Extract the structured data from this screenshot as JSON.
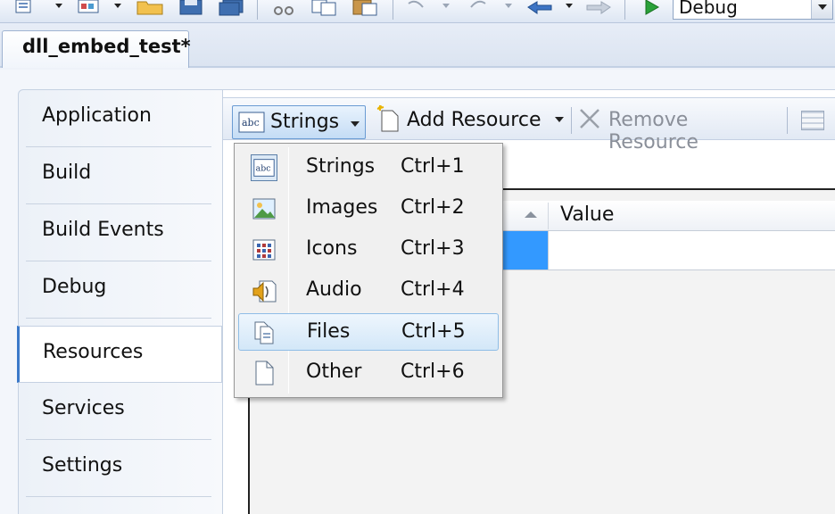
{
  "toolbar": {
    "configuration": "Debug"
  },
  "document_tab": {
    "title": "dll_embed_test*"
  },
  "left_nav": {
    "items": [
      {
        "label": "Application"
      },
      {
        "label": "Build"
      },
      {
        "label": "Build Events"
      },
      {
        "label": "Debug"
      },
      {
        "label": "Resources",
        "selected": true
      },
      {
        "label": "Services"
      },
      {
        "label": "Settings"
      }
    ]
  },
  "resource_toolbar": {
    "category_label": "Strings",
    "add_label": "Add Resource",
    "remove_label": "Remove Resource"
  },
  "grid": {
    "columns": [
      "Value"
    ]
  },
  "category_menu": {
    "items": [
      {
        "label": "Strings",
        "shortcut": "Ctrl+1",
        "icon": "strings-icon"
      },
      {
        "label": "Images",
        "shortcut": "Ctrl+2",
        "icon": "image-icon"
      },
      {
        "label": "Icons",
        "shortcut": "Ctrl+3",
        "icon": "icons-icon"
      },
      {
        "label": "Audio",
        "shortcut": "Ctrl+4",
        "icon": "audio-icon"
      },
      {
        "label": "Files",
        "shortcut": "Ctrl+5",
        "icon": "files-icon",
        "highlighted": true
      },
      {
        "label": "Other",
        "shortcut": "Ctrl+6",
        "icon": "document-icon"
      }
    ]
  },
  "colors": {
    "selection": "#3399ff",
    "accent": "#3a78c9",
    "menu_highlight": "#d3e7f8"
  }
}
